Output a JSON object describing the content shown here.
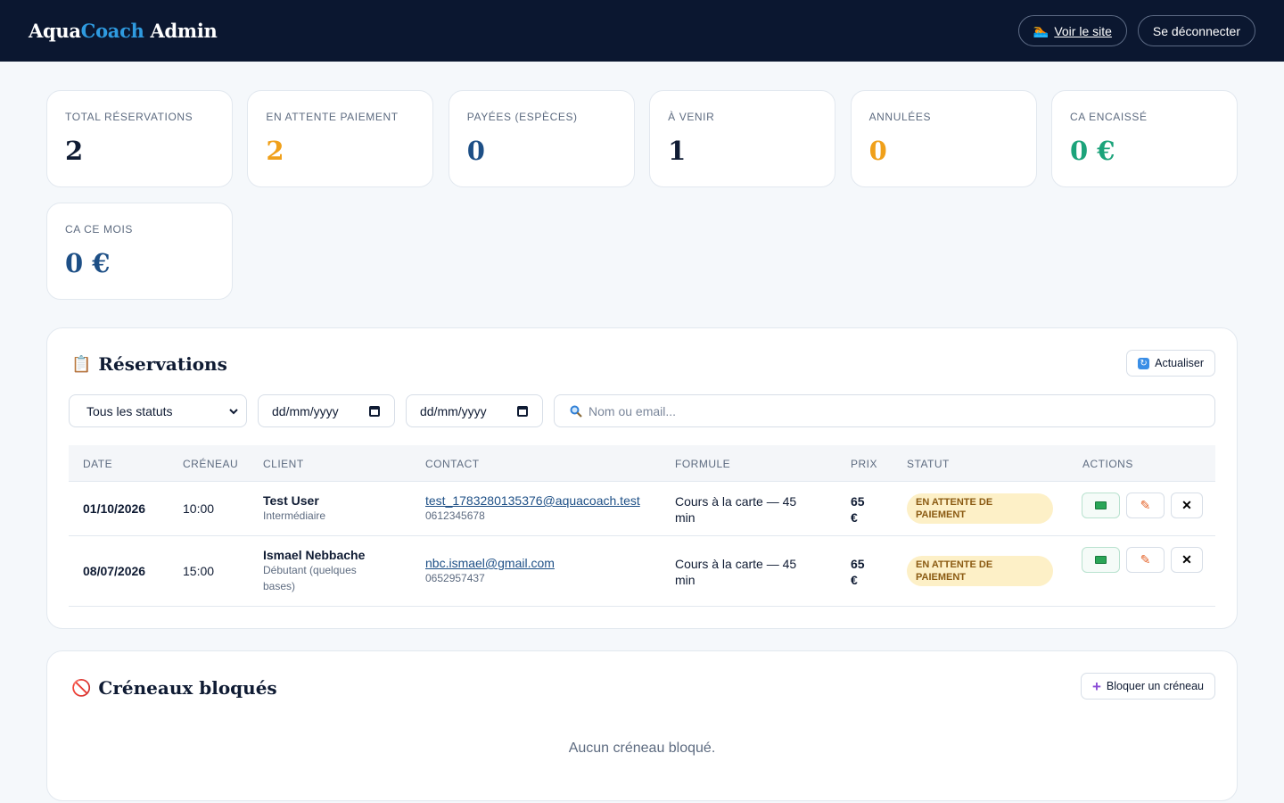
{
  "header": {
    "brand_part1": "Aqua",
    "brand_part2": "Coach",
    "brand_part3": " Admin",
    "view_site_icon": "🏊",
    "view_site_label": "Voir le site",
    "logout_label": "Se déconnecter"
  },
  "stats": [
    {
      "label": "TOTAL RÉSERVATIONS",
      "value": "2",
      "color": "#0f1b33"
    },
    {
      "label": "EN ATTENTE PAIEMENT",
      "value": "2",
      "color": "#f0a01a"
    },
    {
      "label": "PAYÉES (ESPÈCES)",
      "value": "0",
      "color": "#1d4f86"
    },
    {
      "label": "À VENIR",
      "value": "1",
      "color": "#0f1b33"
    },
    {
      "label": "ANNULÉES",
      "value": "0",
      "color": "#f0a01a"
    },
    {
      "label": "CA ENCAISSÉ",
      "value": "0 €",
      "color": "#1ba37a"
    },
    {
      "label": "CA CE MOIS",
      "value": "0 €",
      "color": "#1d4f86"
    }
  ],
  "reservations": {
    "title_icon": "📋",
    "title": "Réservations",
    "refresh_label": "Actualiser",
    "filters": {
      "status_selected": "Tous les statuts",
      "date_from": "dd/mm/yyyy",
      "date_to": "dd/mm/yyyy",
      "search_placeholder": "Nom ou email..."
    },
    "columns": [
      "DATE",
      "CRÉNEAU",
      "CLIENT",
      "CONTACT",
      "FORMULE",
      "PRIX",
      "STATUT",
      "ACTIONS"
    ],
    "rows": [
      {
        "date": "01/10/2026",
        "slot": "10:00",
        "client_name": "Test User",
        "client_level": "Intermédiaire",
        "email": "test_1783280135376@aquacoach.test",
        "phone": "0612345678",
        "formula_line1": "Cours à la carte — 45",
        "formula_line2": "min",
        "price_line1": "65",
        "price_line2": "€",
        "status_line1": "EN ATTENTE DE",
        "status_line2": "PAIEMENT"
      },
      {
        "date": "08/07/2026",
        "slot": "15:00",
        "client_name": "Ismael Nebbache",
        "client_level_line1": "Débutant (quelques",
        "client_level_line2": "bases)",
        "email": "nbc.ismael@gmail.com",
        "phone": "0652957437",
        "formula_line1": "Cours à la carte — 45",
        "formula_line2": "min",
        "price_line1": "65",
        "price_line2": "€",
        "status_line1": "EN ATTENTE DE",
        "status_line2": "PAIEMENT"
      }
    ],
    "status_badge_color": "#fdf0c7"
  },
  "blocked": {
    "title_icon": "🚫",
    "title": "Créneaux bloqués",
    "add_label": "Bloquer un créneau",
    "empty_text": "Aucun créneau bloqué."
  }
}
